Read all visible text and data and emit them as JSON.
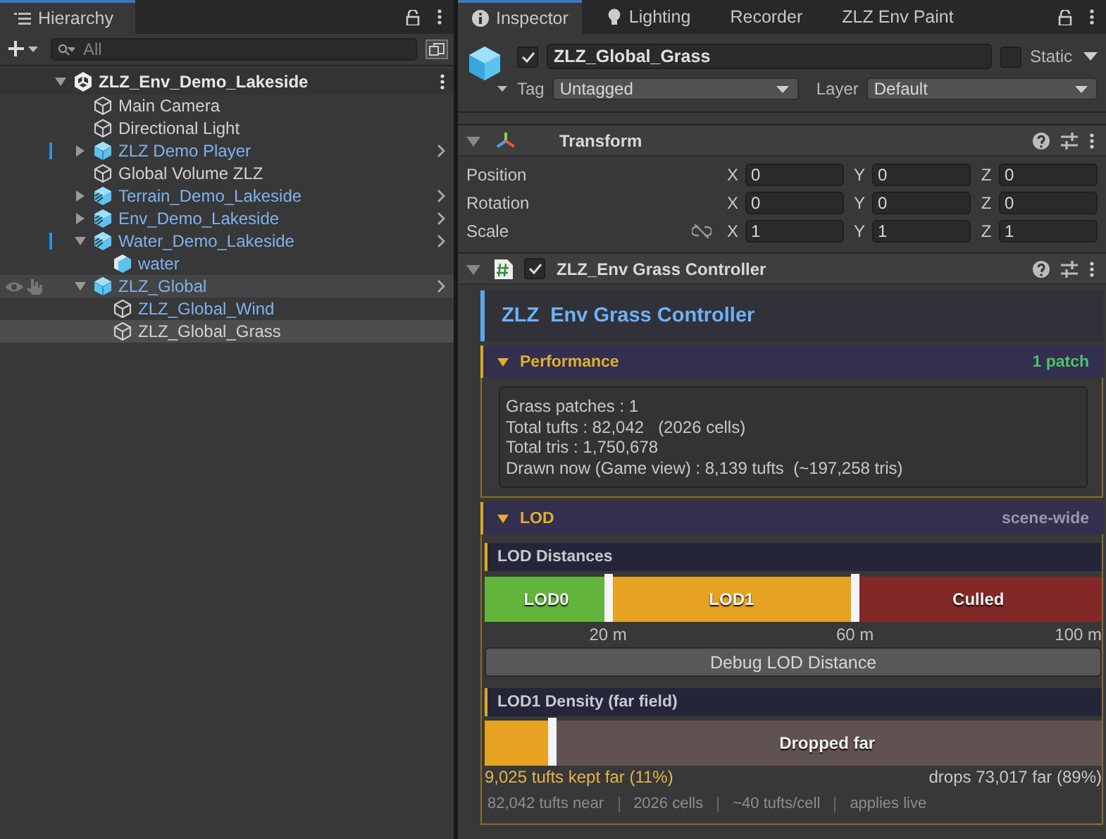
{
  "hierarchy": {
    "title": "Hierarchy",
    "search": {
      "placeholder": "All"
    },
    "items": [
      {
        "name": "ZLZ_Env_Demo_Lakeside",
        "kind": "scene",
        "expanded": true,
        "selected": false,
        "hovered": false,
        "overrides": false,
        "children": [
          {
            "name": "Main Camera",
            "kind": "object",
            "selected": false,
            "hovered": false,
            "overrides": false
          },
          {
            "name": "Directional Light",
            "kind": "object",
            "selected": false,
            "hovered": false,
            "overrides": false
          },
          {
            "name": "ZLZ Demo Player",
            "kind": "prefab",
            "expanded": false,
            "selected": false,
            "hovered": false,
            "overrides": true
          },
          {
            "name": "Global Volume ZLZ",
            "kind": "object",
            "selected": false,
            "hovered": false,
            "overrides": false
          },
          {
            "name": "Terrain_Demo_Lakeside",
            "kind": "variant",
            "expanded": false,
            "selected": false,
            "hovered": false,
            "overrides": false
          },
          {
            "name": "Env_Demo_Lakeside",
            "kind": "variant",
            "expanded": false,
            "selected": false,
            "hovered": false,
            "overrides": false
          },
          {
            "name": "Water_Demo_Lakeside",
            "kind": "variant",
            "expanded": true,
            "selected": false,
            "hovered": false,
            "overrides": true,
            "children": [
              {
                "name": "water",
                "kind": "model",
                "selected": false,
                "hovered": false,
                "overrides": false
              }
            ]
          },
          {
            "name": "ZLZ_Global",
            "kind": "prefab",
            "expanded": true,
            "selected": false,
            "hovered": true,
            "overrides": false,
            "children": [
              {
                "name": "ZLZ_Global_Wind",
                "kind": "prefab-object",
                "selected": false,
                "hovered": false,
                "overrides": false
              },
              {
                "name": "ZLZ_Global_Grass",
                "kind": "object",
                "selected": true,
                "hovered": false,
                "overrides": false
              }
            ]
          }
        ]
      }
    ]
  },
  "inspector": {
    "tabs": [
      {
        "label": "Inspector",
        "kind": "info",
        "selected": true
      },
      {
        "label": "Lighting",
        "kind": "light",
        "selected": false
      },
      {
        "label": "Recorder",
        "kind": "plain",
        "selected": false
      },
      {
        "label": "ZLZ Env Paint",
        "kind": "plain",
        "selected": false
      }
    ],
    "object": {
      "active": true,
      "name": "ZLZ_Global_Grass",
      "static": false,
      "static_label": "Static",
      "tag_label": "Tag",
      "tag": "Untagged",
      "layer_label": "Layer",
      "layer": "Default"
    },
    "transform": {
      "title": "Transform",
      "expanded": true,
      "rows": [
        {
          "label": "Position",
          "values": [
            {
              "axis": "X",
              "value": "0"
            },
            {
              "axis": "Y",
              "value": "0"
            },
            {
              "axis": "Z",
              "value": "0"
            }
          ]
        },
        {
          "label": "Rotation",
          "values": [
            {
              "axis": "X",
              "value": "0"
            },
            {
              "axis": "Y",
              "value": "0"
            },
            {
              "axis": "Z",
              "value": "0"
            }
          ]
        },
        {
          "label": "Scale",
          "constrained": false,
          "values": [
            {
              "axis": "X",
              "value": "1"
            },
            {
              "axis": "Y",
              "value": "1"
            },
            {
              "axis": "Z",
              "value": "1"
            }
          ]
        }
      ]
    },
    "component": {
      "title": "ZLZ_Env Grass Controller",
      "enabled": true,
      "expanded": true,
      "banner": "ZLZ  Env Grass Controller",
      "sections": [
        {
          "kind": "stats",
          "title": "Performance",
          "expanded": true,
          "badge": {
            "text": "1 patch",
            "color": "#4cc26a"
          },
          "lines": [
            "Grass patches : 1",
            "Total tufts : 82,042   (2026 cells)",
            "Total tris : 1,750,678",
            "Drawn now (Game view) : 8,139 tufts  (~197,258 tris)"
          ]
        },
        {
          "kind": "lod",
          "title": "LOD",
          "expanded": true,
          "badge": {
            "text": "scene-wide",
            "color": "#9a98a8"
          },
          "distances": {
            "title": "LOD Distances",
            "segments": [
              {
                "label": "LOD0",
                "color": "#62b53a",
                "level": 0.2
              },
              {
                "label": "LOD1",
                "color": "#e5a321",
                "level": 0.4
              },
              {
                "label": "Culled",
                "color": "#822826",
                "level": 0.4
              }
            ],
            "ticks": [
              "20 m",
              "60 m",
              "100 m"
            ]
          },
          "button": "Debug LOD Distance",
          "density": {
            "title": "LOD1 Density (far field)",
            "level": 0.11,
            "dropped_label": "Dropped far",
            "kept": "9,025 tufts kept far (11%)",
            "dropped": "drops 73,017 far (89%)"
          },
          "footer": [
            "82,042 tufts near",
            "2026 cells",
            "~40 tufts/cell",
            "applies live"
          ]
        }
      ]
    }
  }
}
